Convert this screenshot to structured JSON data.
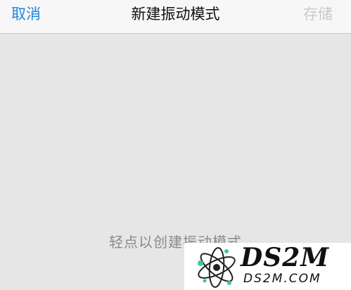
{
  "navbar": {
    "cancel_label": "取消",
    "title": "新建振动模式",
    "save_label": "存储"
  },
  "canvas": {
    "hint": "轻点以创建振动模式"
  },
  "watermark": {
    "logo_icon": "atom-icon",
    "title": "DS2M",
    "subtitle": "DS2M.COM"
  },
  "colors": {
    "accent": "#1a86e8",
    "disabled": "#c9c9c9",
    "background": "#e6e6e6"
  }
}
